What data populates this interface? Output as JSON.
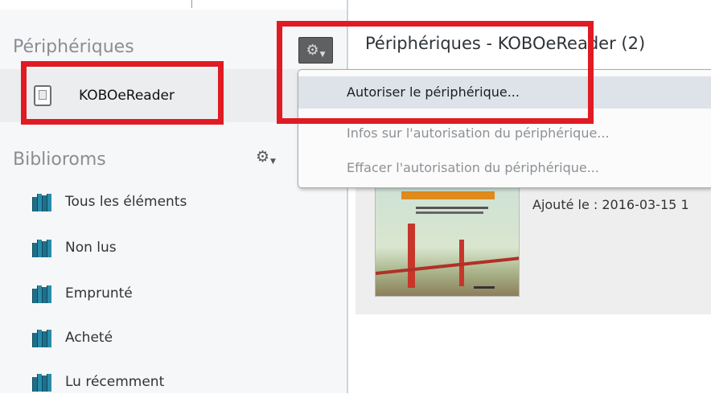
{
  "sidebar": {
    "devices_heading": "Périphériques",
    "device": {
      "label": "KOBOeReader",
      "icon": "ereader-icon"
    },
    "libraries_heading": "Biblioroms",
    "libraries_gear_icon": "gear-icon",
    "libraries": [
      {
        "label": "Tous les éléments",
        "icon": "books-icon"
      },
      {
        "label": "Non lus",
        "icon": "books-icon"
      },
      {
        "label": "Emprunté",
        "icon": "books-icon"
      },
      {
        "label": "Acheté",
        "icon": "books-icon"
      },
      {
        "label": "Lu récemment",
        "icon": "books-icon"
      }
    ]
  },
  "main": {
    "title": "Périphériques - KOBOeReader (2)",
    "gear_icon": "gear-icon",
    "book": {
      "added_label": "Ajouté le : 2016-03-15 1"
    }
  },
  "menu": {
    "items": [
      {
        "label": "Autoriser le périphérique...",
        "state": "highlighted"
      },
      {
        "label": "Infos sur l'autorisation du périphérique...",
        "state": "disabled"
      },
      {
        "label": "Effacer l'autorisation du périphérique...",
        "state": "disabled"
      }
    ]
  },
  "colors": {
    "highlight_box": "#e01b24",
    "menu_active_bg": "#dde3e9",
    "sidebar_bg": "#f6f7f8",
    "library_icon": "#1f6f8b"
  }
}
